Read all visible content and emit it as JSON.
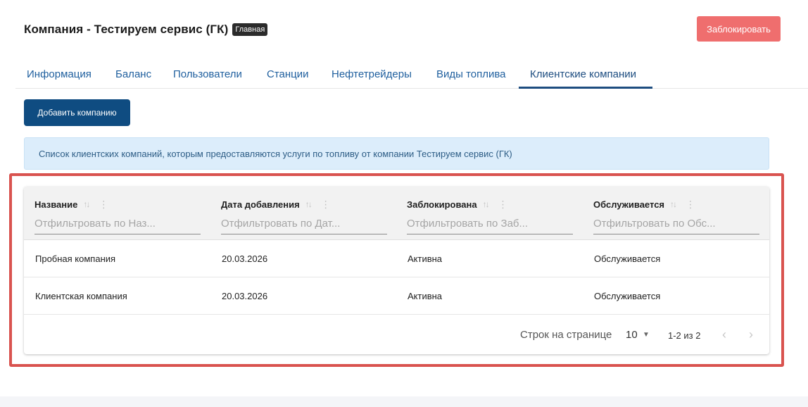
{
  "header": {
    "title": "Компания - Тестируем сервис (ГК)",
    "badge": "Главная",
    "block_button": "Заблокировать"
  },
  "tabs": [
    {
      "label": "Информация",
      "active": false
    },
    {
      "label": "Баланс",
      "active": false
    },
    {
      "label": "Пользователи",
      "active": false
    },
    {
      "label": "Станции",
      "active": false
    },
    {
      "label": "Нефтетрейдеры",
      "active": false
    },
    {
      "label": "Виды топлива",
      "active": false
    },
    {
      "label": "Клиентские компании",
      "active": true
    }
  ],
  "add_button": "Добавить компанию",
  "info_banner": "Список клиентских компаний, которым предоставляются услуги по топливу от компании Тестируем сервис (ГК)",
  "table": {
    "columns": [
      {
        "title": "Название",
        "filter_placeholder": "Отфильтровать по Наз..."
      },
      {
        "title": "Дата добавления",
        "filter_placeholder": "Отфильтровать по Дат..."
      },
      {
        "title": "Заблокирована",
        "filter_placeholder": "Отфильтровать по Заб..."
      },
      {
        "title": "Обслуживается",
        "filter_placeholder": "Отфильтровать по Обс..."
      }
    ],
    "rows": [
      [
        "Пробная компания",
        "20.03.2026",
        "Активна",
        "Обслуживается"
      ],
      [
        "Клиентская компания",
        "20.03.2026",
        "Активна",
        "Обслуживается"
      ]
    ],
    "pagination": {
      "rows_per_page_label": "Строк на странице",
      "rows_per_page_value": "10",
      "range": "1-2 из 2"
    }
  },
  "icons": {
    "sort": "sort-icon",
    "column_menu": "kebab-menu-icon",
    "dropdown": "caret-down-icon",
    "prev": "chevron-left-icon",
    "next": "chevron-right-icon"
  },
  "colors": {
    "primary": "#0f4c81",
    "danger": "#ef6e6e",
    "tab_text": "#1f5f9e",
    "banner_bg": "#dcedfb",
    "highlight": "#d9534f"
  }
}
